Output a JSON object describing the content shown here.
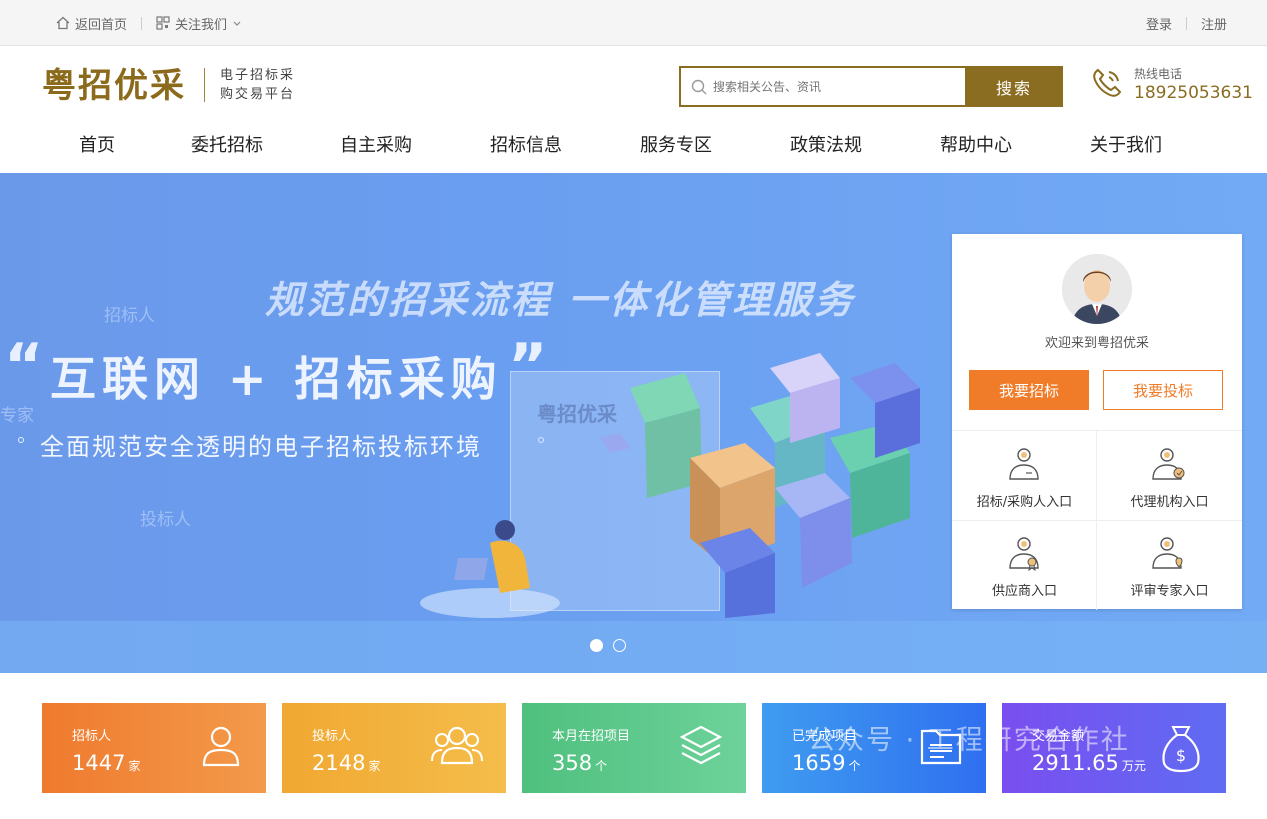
{
  "topbar": {
    "home_label": "返回首页",
    "follow_label": "关注我们",
    "login_label": "登录",
    "register_label": "注册"
  },
  "header": {
    "logo_text": "粤招优采",
    "logo_sub_1": "电子招标采",
    "logo_sub_2": "购交易平台",
    "search_placeholder": "搜索相关公告、资讯",
    "search_button": "搜索",
    "hotline_label": "热线电话",
    "hotline_number": "18925053631"
  },
  "nav": {
    "items": [
      "首页",
      "委托招标",
      "自主采购",
      "招标信息",
      "服务专区",
      "政策法规",
      "帮助中心",
      "关于我们"
    ]
  },
  "banner": {
    "title": "规范的招采流程 一体化管理服务",
    "slogan": "互联网 + 招标采购",
    "quote_open": "“",
    "quote_close": "”",
    "subtitle": "全面规范安全透明的电子招标投标环境",
    "faint_1": "招标人",
    "faint_2": "专家",
    "faint_3": "投标人",
    "glass_text": "粤招优采",
    "slides": 2,
    "active_slide": 1
  },
  "login_panel": {
    "welcome": "欢迎来到粤招优采",
    "btn_tender": "我要招标",
    "btn_bid": "我要投标",
    "entries": [
      "招标/采购人入口",
      "代理机构入口",
      "供应商入口",
      "评审专家入口"
    ]
  },
  "stats": [
    {
      "title": "招标人",
      "value": "1447",
      "unit": "家",
      "icon": "user-icon",
      "color_from": "#ef7a2e",
      "color_to": "#f39a4a"
    },
    {
      "title": "投标人",
      "value": "2148",
      "unit": "家",
      "icon": "users-icon",
      "color_from": "#f0a832",
      "color_to": "#f5bd4a"
    },
    {
      "title": "本月在招项目",
      "value": "358",
      "unit": "个",
      "icon": "layers-icon",
      "color_from": "#4fc07e",
      "color_to": "#6dd29a"
    },
    {
      "title": "已完成项目",
      "value": "1659",
      "unit": "个",
      "icon": "folder-list-icon",
      "color_from": "#3f9cf0",
      "color_to": "#2f6ff0"
    },
    {
      "title": "交易金额",
      "value": "2911.65",
      "unit": "万元",
      "icon": "money-bag-icon",
      "color_from": "#7a4ef0",
      "color_to": "#5f6cf2"
    }
  ],
  "watermark": "公众号 · 工程研究合作社"
}
